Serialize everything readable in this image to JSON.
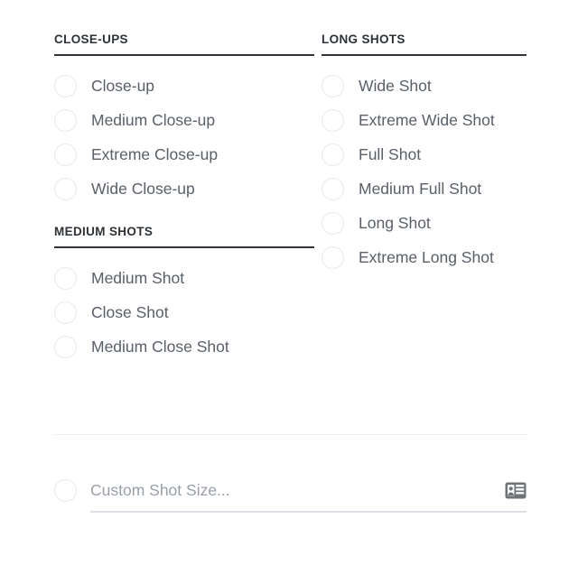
{
  "panel": {
    "name": "shot-size-picker",
    "background": "#ffffff",
    "accent_rule_color": "#2f343a",
    "text_color": "#5a6068",
    "header_color": "#2d3237",
    "radio_border_color": "#e9e9ea",
    "placeholder_color": "#9aa0a8",
    "icon_color": "#6e7378"
  },
  "columns": {
    "left": [
      {
        "id": "close-ups",
        "title": "CLOSE-UPS",
        "options": [
          {
            "label": "Close-up",
            "selected": false
          },
          {
            "label": "Medium Close-up",
            "selected": false
          },
          {
            "label": "Extreme Close-up",
            "selected": false
          },
          {
            "label": "Wide Close-up",
            "selected": false
          }
        ]
      },
      {
        "id": "medium-shots",
        "title": "MEDIUM SHOTS",
        "options": [
          {
            "label": "Medium Shot",
            "selected": false
          },
          {
            "label": "Close Shot",
            "selected": false
          },
          {
            "label": "Medium Close Shot",
            "selected": false
          }
        ]
      }
    ],
    "right": [
      {
        "id": "long-shots",
        "title": "LONG SHOTS",
        "options": [
          {
            "label": "Wide Shot",
            "selected": false
          },
          {
            "label": "Extreme Wide Shot",
            "selected": false
          },
          {
            "label": "Full Shot",
            "selected": false
          },
          {
            "label": "Medium Full Shot",
            "selected": false
          },
          {
            "label": "Long Shot",
            "selected": false
          },
          {
            "label": "Extreme Long Shot",
            "selected": false
          }
        ]
      }
    ]
  },
  "custom": {
    "radio_selected": false,
    "value": "",
    "placeholder": "Custom Shot Size...",
    "icon": "contact-card-icon"
  }
}
